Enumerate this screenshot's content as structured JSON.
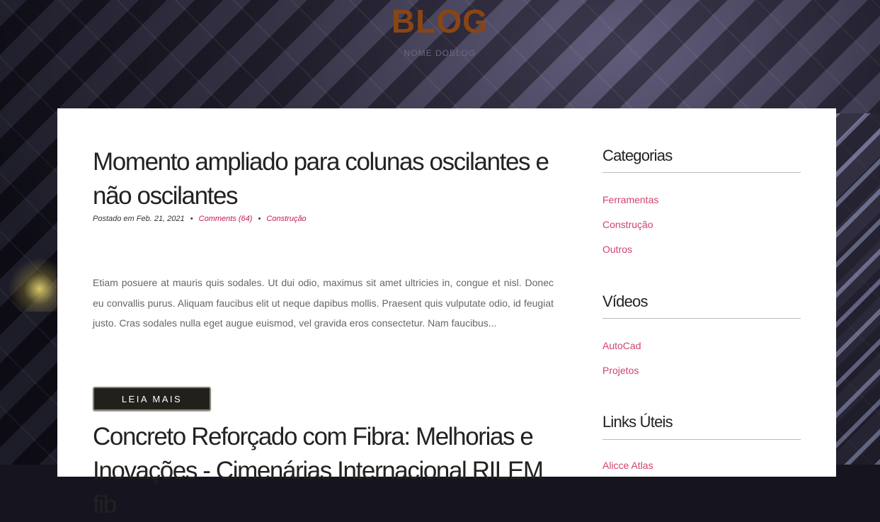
{
  "header": {
    "title": "BLOG",
    "subtitle": "NOME DOBLOG"
  },
  "posts": [
    {
      "title": "Momento ampliado para colunas oscilantes e não oscilantes",
      "meta_prefix": "Postado em Feb. 21, 2021",
      "meta_separator": "•",
      "comments": "Comments (64)",
      "category": "Construção",
      "excerpt": "Etiam posuere at mauris quis sodales. Ut dui odio, maximus sit amet ultricies in, congue et nisl. Donec eu convallis purus. Aliquam faucibus elit ut neque dapibus mollis. Praesent quis vulputate odio, id feugiat justo. Cras sodales nulla eget augue euismod, vel gravida eros consectetur. Nam faucibus...",
      "read_more": "LEIA MAIS"
    },
    {
      "title": "Concreto Reforçado com Fibra: Melhorias e Inovações - Cimenárias Internacional RILEM fib"
    }
  ],
  "sidebar": {
    "categories": {
      "title": "Categorias",
      "items": [
        "Ferramentas",
        "Construção",
        "Outros"
      ]
    },
    "videos": {
      "title": "Vídeos",
      "items": [
        "AutoCad",
        "Projetos"
      ]
    },
    "links": {
      "title": "Links Úteis",
      "items": [
        "Alicce Atlas"
      ]
    }
  },
  "colors": {
    "brand_title": "#8b4513",
    "link_pink": "#d2436b",
    "button_bg": "#231f1a"
  }
}
